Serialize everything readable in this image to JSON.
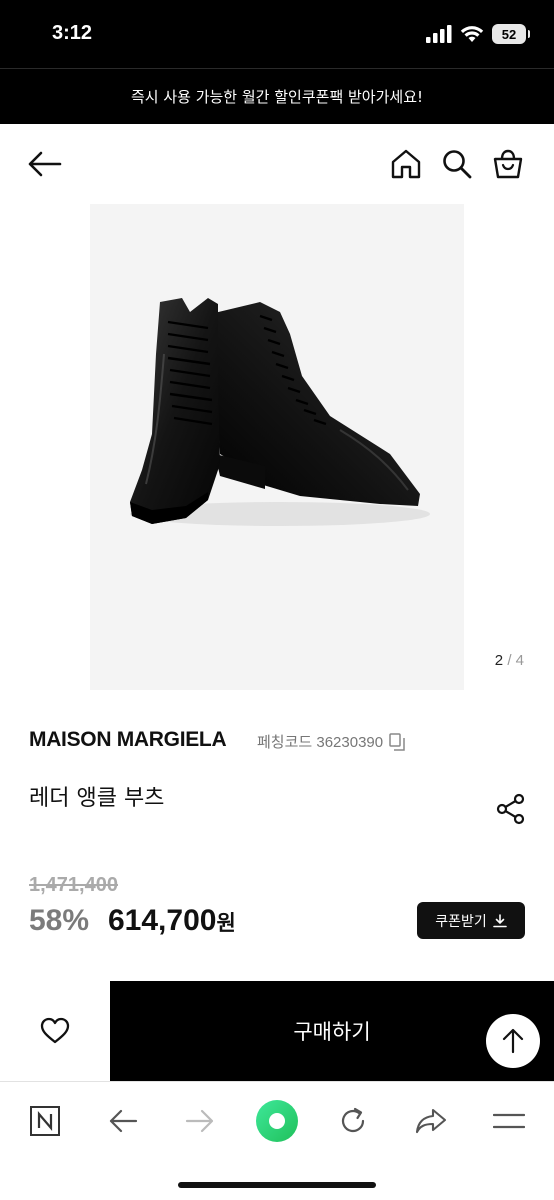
{
  "status_bar": {
    "time": "3:12",
    "battery": "52"
  },
  "promo_banner": {
    "text": "즉시 사용 가능한 월간 할인쿠폰팩 받아가세요!"
  },
  "header": {
    "back_icon": "arrow-left-icon",
    "home_icon": "home-icon",
    "search_icon": "search-icon",
    "cart_icon": "shopping-bag-icon"
  },
  "gallery": {
    "current": "2",
    "separator": "/",
    "total": "4"
  },
  "product": {
    "brand": "MAISON MARGIELA",
    "code_label": "페칭코드 36230390",
    "name": "레더 앵클 부츠"
  },
  "price": {
    "original": "1,471,400",
    "discount": "58%",
    "final": "614,700",
    "currency": "원"
  },
  "coupon_button": {
    "label": "쿠폰받기"
  },
  "purchase": {
    "buy_label": "구매하기"
  },
  "browser_bar": {
    "icons": [
      "naver-icon",
      "back-icon",
      "forward-icon",
      "green-dot-icon",
      "refresh-icon",
      "share-icon",
      "menu-icon"
    ]
  },
  "colors": {
    "black": "#000000",
    "discount_gray": "#7b7b7b",
    "green": "#2fd36f"
  }
}
